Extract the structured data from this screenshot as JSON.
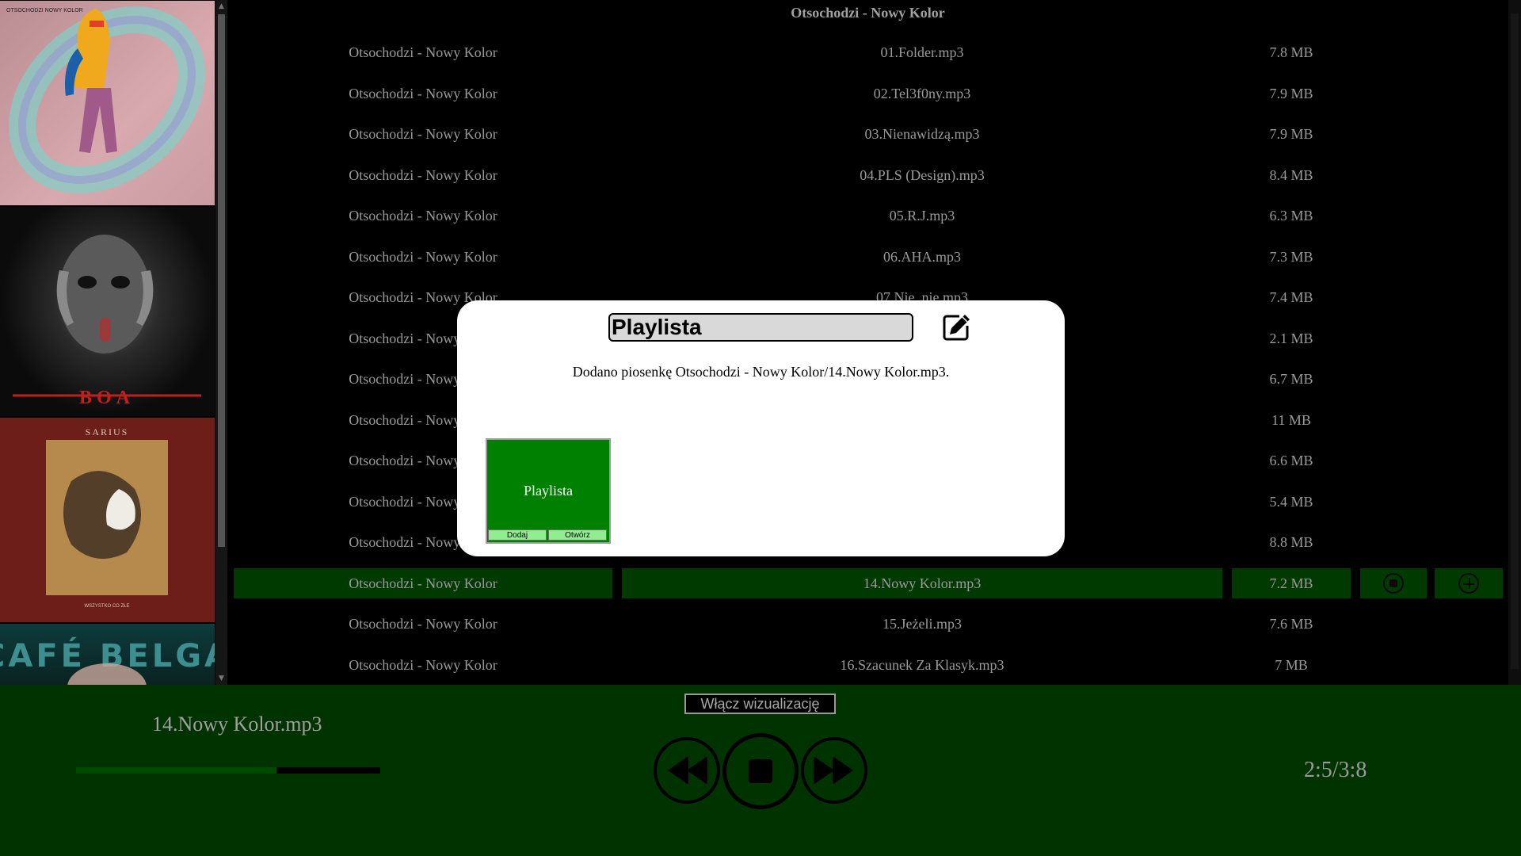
{
  "list": {
    "header": "Otsochodzi - Nowy Kolor",
    "rows": [
      {
        "album": "Otsochodzi - Nowy Kolor",
        "title": "01.Folder.mp3",
        "size": "7.8 MB"
      },
      {
        "album": "Otsochodzi - Nowy Kolor",
        "title": "02.Tel3f0ny.mp3",
        "size": "7.9 MB"
      },
      {
        "album": "Otsochodzi - Nowy Kolor",
        "title": "03.Nienawidzą.mp3",
        "size": "7.9 MB"
      },
      {
        "album": "Otsochodzi - Nowy Kolor",
        "title": "04.PLS (Design).mp3",
        "size": "8.4 MB"
      },
      {
        "album": "Otsochodzi - Nowy Kolor",
        "title": "05.R.J.mp3",
        "size": "6.3 MB"
      },
      {
        "album": "Otsochodzi - Nowy Kolor",
        "title": "06.AHA.mp3",
        "size": "7.3 MB"
      },
      {
        "album": "Otsochodzi - Nowy Kolor",
        "title": "07.Nie, nie.mp3",
        "size": "7.4 MB"
      },
      {
        "album": "Otsochodzi - Nowy Kolor",
        "title": "",
        "size": "2.1 MB"
      },
      {
        "album": "Otsochodzi - Nowy Kolor",
        "title": "",
        "size": "6.7 MB"
      },
      {
        "album": "Otsochodzi - Nowy Kolor",
        "title": "",
        "size": "11 MB"
      },
      {
        "album": "Otsochodzi - Nowy Kolor",
        "title": "",
        "size": "6.6 MB"
      },
      {
        "album": "Otsochodzi - Nowy Kolor",
        "title": "",
        "size": "5.4 MB"
      },
      {
        "album": "Otsochodzi - Nowy Kolor",
        "title": "",
        "size": "8.8 MB"
      },
      {
        "album": "Otsochodzi - Nowy Kolor",
        "title": "14.Nowy Kolor.mp3",
        "size": "7.2 MB",
        "active": true
      },
      {
        "album": "Otsochodzi - Nowy Kolor",
        "title": "15.Jeżeli.mp3",
        "size": "7.6 MB"
      },
      {
        "album": "Otsochodzi - Nowy Kolor",
        "title": "16.Szacunek Za Klasyk.mp3",
        "size": "7 MB"
      }
    ],
    "row_icons": [
      "stop-circle-icon",
      "plus-circle-icon"
    ]
  },
  "covers": {
    "cover1_text": "OTSOCHODZI NOWY KOLOR",
    "cover2_text": "BOA",
    "cover3_top": "SARIUS",
    "cover3_bottom": "WSZYSTKO CO ZŁE",
    "cover4_text": "CAFÉ BELGA"
  },
  "modal": {
    "playlist_name": "Playlista",
    "message": "Dodano piosenkę Otsochodzi - Nowy Kolor/14.Nowy Kolor.mp3.",
    "edit_icon": "edit-pencil-icon",
    "card": {
      "name": "Playlista",
      "add_label": "Dodaj",
      "open_label": "Otwórz"
    }
  },
  "player": {
    "visualization_label": "Włącz wizualizację",
    "now_playing": "14.Nowy Kolor.mp3",
    "progress": 0.66,
    "time": "2:5/3:8"
  },
  "colors": {
    "active_row": "#013a01",
    "player_bg": "#013301",
    "playlist_card": "#008000",
    "card_buttons": "#90ee90"
  }
}
